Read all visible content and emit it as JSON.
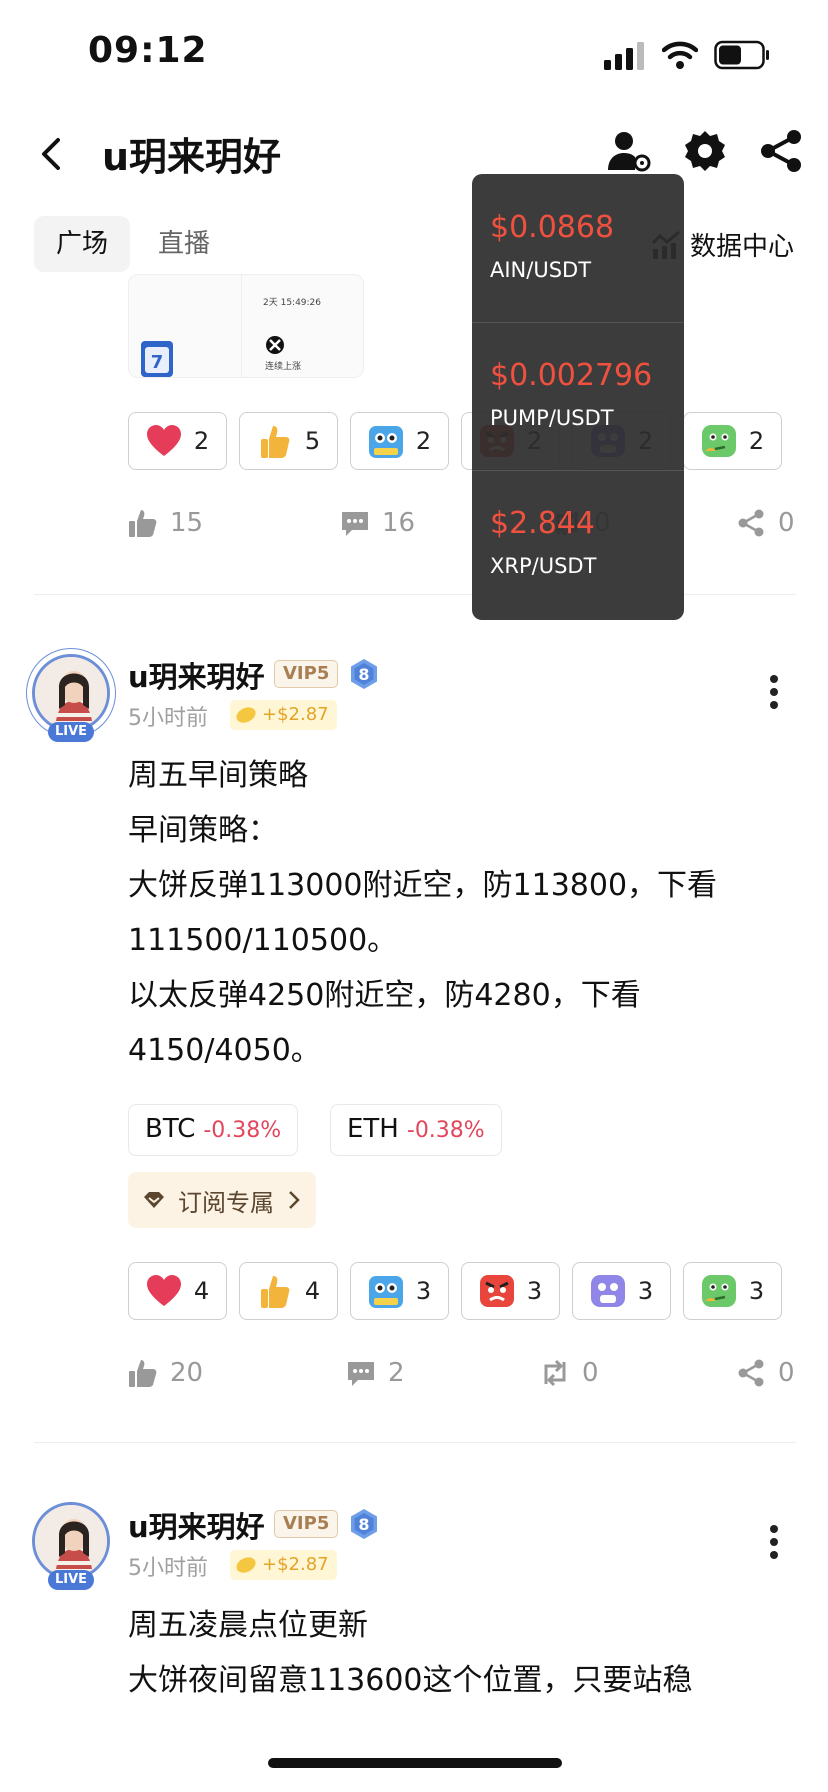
{
  "status_bar": {
    "time": "09:12"
  },
  "header": {
    "title": "u玥来玥好"
  },
  "tabs": [
    {
      "label": "广场"
    },
    {
      "label": "直播"
    }
  ],
  "data_center": {
    "label": "数据中心"
  },
  "prev_post": {
    "image": {
      "line1": "2天 15:49:26",
      "line2": "连续上涨"
    },
    "reactions": [
      {
        "emoji": "heart-icon",
        "count": "2"
      },
      {
        "emoji": "thumbs-up-icon",
        "count": "5"
      },
      {
        "emoji": "hodl-icon",
        "count": "2"
      },
      {
        "emoji": "angry-icon",
        "count": "2"
      },
      {
        "emoji": "scared-icon",
        "count": "2"
      },
      {
        "emoji": "thinking-icon",
        "count": "2"
      }
    ],
    "actions": {
      "likes": "15",
      "comments": "16",
      "reposts": "0",
      "shares": "0"
    }
  },
  "popup": {
    "items": [
      {
        "price": "$0.0868",
        "pair": "AIN/USDT"
      },
      {
        "price": "$0.002796",
        "pair": "PUMP/USDT"
      },
      {
        "price": "$2.844",
        "pair": "XRP/USDT"
      }
    ]
  },
  "post1": {
    "author": "u玥来玥好",
    "vip": "VIP5",
    "level": "8",
    "live": "LIVE",
    "time": "5小时前",
    "earn": "+$2.87",
    "lines": [
      "周五早间策略",
      "早间策略：",
      "大饼反弹113000附近空，防113800，下看",
      "111500/110500。",
      "以太反弹4250附近空，防4280，下看",
      "4150/4050。"
    ],
    "tickers": [
      {
        "symbol": "BTC",
        "change": "-0.38%"
      },
      {
        "symbol": "ETH",
        "change": "-0.38%"
      }
    ],
    "subscribe": "订阅专属",
    "reactions": [
      {
        "emoji": "heart-icon",
        "count": "4"
      },
      {
        "emoji": "thumbs-up-icon",
        "count": "4"
      },
      {
        "emoji": "hodl-icon",
        "count": "3"
      },
      {
        "emoji": "angry-icon",
        "count": "3"
      },
      {
        "emoji": "scared-icon",
        "count": "3"
      },
      {
        "emoji": "thinking-icon",
        "count": "3"
      }
    ],
    "actions": {
      "likes": "20",
      "comments": "2",
      "reposts": "0",
      "shares": "0"
    }
  },
  "post2": {
    "author": "u玥来玥好",
    "vip": "VIP5",
    "level": "8",
    "live": "LIVE",
    "time": "5小时前",
    "earn": "+$2.87",
    "lines": [
      "周五凌晨点位更新",
      "大饼夜间留意113600这个位置，只要站稳"
    ]
  },
  "colors": {
    "accent_red": "#f0513f",
    "negative": "#e1465c",
    "live_blue": "#4a78d6",
    "vip_gold": "#a77f53"
  }
}
